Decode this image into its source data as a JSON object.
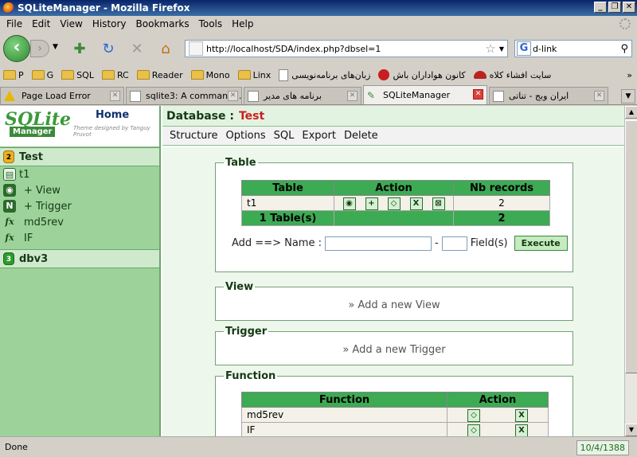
{
  "window": {
    "title": "SQLiteManager - Mozilla Firefox"
  },
  "menu": [
    "File",
    "Edit",
    "View",
    "History",
    "Bookmarks",
    "Tools",
    "Help"
  ],
  "nav": {
    "url": "http://localhost/SDA/index.php?dbsel=1",
    "search_value": "d-link",
    "search_engine": "G"
  },
  "bookmarks": [
    "P",
    "G",
    "SQL",
    "RC",
    "Reader",
    "Mono",
    "Linx",
    "زبان‌های برنامه‌نویسی",
    "کانون هواداران باش",
    "سایت افشاء کلاه"
  ],
  "tabs": [
    {
      "label": "Page Load Error"
    },
    {
      "label": "sqlite3: A command..."
    },
    {
      "label": "برنامه های مدیر"
    },
    {
      "label": "SQLiteManager"
    },
    {
      "label": "ایران وبج - تناتی"
    }
  ],
  "left": {
    "logo_text": "SQLite",
    "logo_sub": "Manager",
    "logo_credit": "Theme designed by Tanguy Pruvot",
    "home": "Home",
    "db1": {
      "num": "2",
      "name": "Test"
    },
    "items": [
      {
        "label": "t1",
        "icon": "table-icon"
      },
      {
        "label": "+ View",
        "icon": "view-icon"
      },
      {
        "label": "+ Trigger",
        "icon": "trigger-icon"
      },
      {
        "label": "md5rev",
        "icon": "function-icon"
      },
      {
        "label": "IF",
        "icon": "function-icon"
      }
    ],
    "db2": {
      "num": "3",
      "name": "dbv3"
    }
  },
  "main": {
    "db_label": "Database :",
    "db_name": "Test",
    "actions": [
      "Structure",
      "Options",
      "SQL",
      "Export",
      "Delete"
    ],
    "table_legend": "Table",
    "table_headers": [
      "Table",
      "Action",
      "Nb records"
    ],
    "table_rows": [
      {
        "name": "t1",
        "records": "2"
      }
    ],
    "table_total": {
      "label": "1 Table(s)",
      "records": "2"
    },
    "add_label": "Add ==> Name :",
    "dash": "-",
    "fields_label": "Field(s)",
    "execute": "Execute",
    "view_legend": "View",
    "view_link": "» Add a new View",
    "trigger_legend": "Trigger",
    "trigger_link": "» Add a new Trigger",
    "function_legend": "Function",
    "function_headers": [
      "Function",
      "Action"
    ],
    "function_rows": [
      "md5rev",
      "IF"
    ]
  },
  "status": {
    "text": "Done",
    "date": "10/4/1388"
  }
}
